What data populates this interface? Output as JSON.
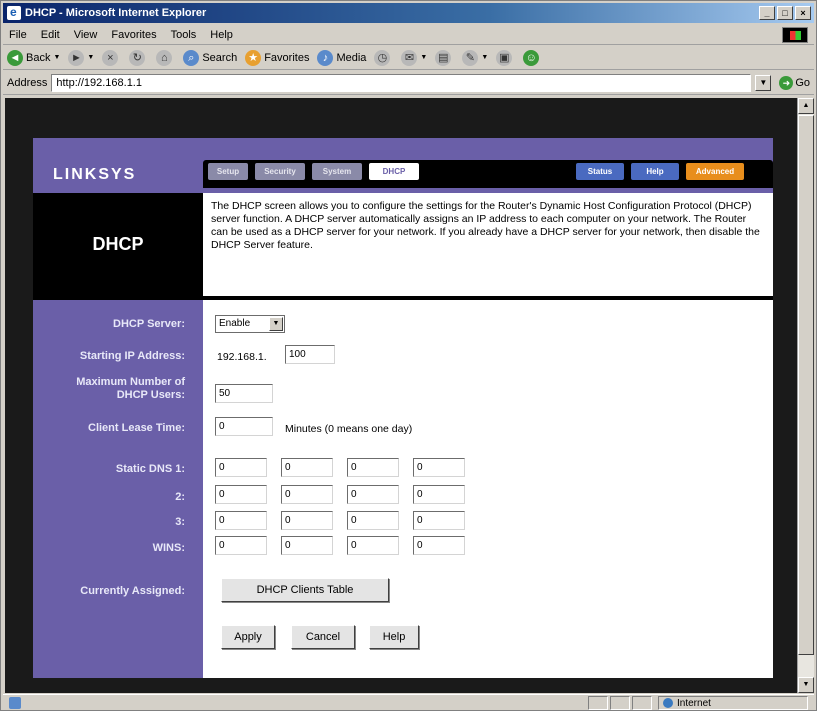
{
  "window": {
    "title": "DHCP - Microsoft Internet Explorer",
    "controls": [
      "_",
      "□",
      "×"
    ]
  },
  "menu": [
    "File",
    "Edit",
    "View",
    "Favorites",
    "Tools",
    "Help"
  ],
  "toolbar": {
    "back": "Back",
    "search": "Search",
    "favorites": "Favorites",
    "media": "Media"
  },
  "address": {
    "label": "Address",
    "url": "http://192.168.1.1",
    "go": "Go"
  },
  "router": {
    "logo": "LINKSYS",
    "tabs": [
      "Setup",
      "Security",
      "System",
      "DHCP"
    ],
    "right_tabs": [
      "Status",
      "Help",
      "Advanced"
    ],
    "page_title": "DHCP",
    "description": "The DHCP screen allows you to configure the settings for the Router's Dynamic Host Configuration Protocol (DHCP) server function. A DHCP server automatically assigns an IP address to each computer on your network. The Router can be used as a DHCP server for your network. If you already have a DHCP server for your network, then disable the DHCP Server feature.",
    "labels": {
      "dhcp_server": "DHCP Server:",
      "starting_ip": "Starting IP Address:",
      "max_users_1": "Maximum Number of",
      "max_users_2": "DHCP Users:",
      "lease_time": "Client Lease Time:",
      "static_dns_1": "Static DNS 1:",
      "static_dns_2": "2:",
      "static_dns_3": "3:",
      "wins": "WINS:",
      "currently_assigned": "Currently Assigned:"
    },
    "values": {
      "dhcp_server": "Enable",
      "ip_prefix": "192.168.1.",
      "starting_ip_last": "100",
      "max_users": "50",
      "lease_time": "0",
      "lease_hint": "Minutes (0 means one day)",
      "dns1": [
        "0",
        "0",
        "0",
        "0"
      ],
      "dns2": [
        "0",
        "0",
        "0",
        "0"
      ],
      "dns3": [
        "0",
        "0",
        "0",
        "0"
      ],
      "wins": [
        "0",
        "0",
        "0",
        "0"
      ]
    },
    "buttons": {
      "clients_table": "DHCP Clients Table",
      "apply": "Apply",
      "cancel": "Cancel",
      "help": "Help"
    }
  },
  "status": {
    "zone": "Internet"
  }
}
